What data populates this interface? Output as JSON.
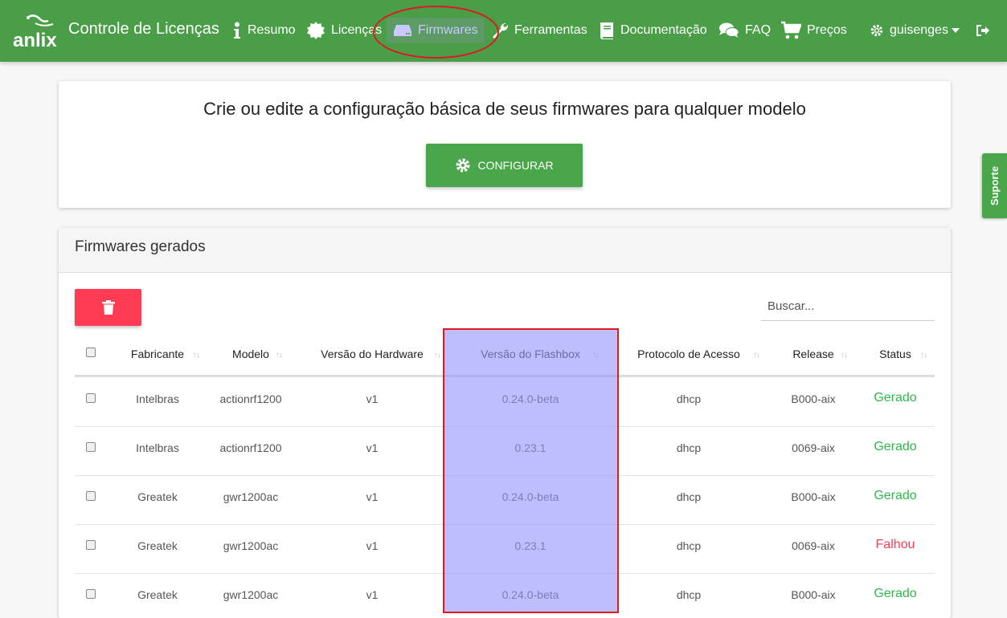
{
  "navbar": {
    "logo_text": "anlix",
    "brand": "Controle de Licenças",
    "items": [
      {
        "label": "Resumo",
        "icon": "info-icon"
      },
      {
        "label": "Licenças",
        "icon": "gear-badge-icon"
      },
      {
        "label": "Firmwares",
        "icon": "hard-drive-icon",
        "active": true
      },
      {
        "label": "Ferramentas",
        "icon": "wrench-icon"
      },
      {
        "label": "Documentação",
        "icon": "book-icon"
      },
      {
        "label": "FAQ",
        "icon": "chat-icon"
      },
      {
        "label": "Preços",
        "icon": "cart-icon"
      }
    ],
    "user": {
      "label": "guisenges",
      "icon": "gear-icon",
      "caret_icon": "caret-down-icon"
    },
    "logout_icon": "sign-out-icon"
  },
  "config_card": {
    "title": "Crie ou edite a configuração básica de seus firmwares para qualquer modelo",
    "button_label": "CONFIGURAR",
    "button_icon": "gear-icon"
  },
  "firmwares_card": {
    "title": "Firmwares gerados",
    "delete_icon": "trash-icon",
    "search_placeholder": "Buscar...",
    "columns": [
      "Fabricante",
      "Modelo",
      "Versão do Hardware",
      "Versão do Flashbox",
      "Protocolo de Acesso",
      "Release",
      "Status"
    ],
    "sort_icon": "↑↓",
    "rows": [
      [
        "Intelbras",
        "actionrf1200",
        "v1",
        "0.24.0-beta",
        "dhcp",
        "B000-aix",
        "Gerado"
      ],
      [
        "Intelbras",
        "actionrf1200",
        "v1",
        "0.23.1",
        "dhcp",
        "0069-aix",
        "Gerado"
      ],
      [
        "Greatek",
        "gwr1200ac",
        "v1",
        "0.24.0-beta",
        "dhcp",
        "B000-aix",
        "Gerado"
      ],
      [
        "Greatek",
        "gwr1200ac",
        "v1",
        "0.23.1",
        "dhcp",
        "0069-aix",
        "Falhou"
      ],
      [
        "Greatek",
        "gwr1200ac",
        "v1",
        "0.24.0-beta",
        "dhcp",
        "B000-aix",
        "Gerado"
      ]
    ]
  },
  "colors": {
    "navbar": "#4a9e48",
    "primary_button": "#4aa64a",
    "delete_button": "#ff3b53",
    "status_ok": "#2eb84a",
    "status_fail": "#ff3b53",
    "column_highlight": "#9696ff",
    "annotation_outline": "#e0191f"
  },
  "support_tab": {
    "label": "Suporte"
  }
}
